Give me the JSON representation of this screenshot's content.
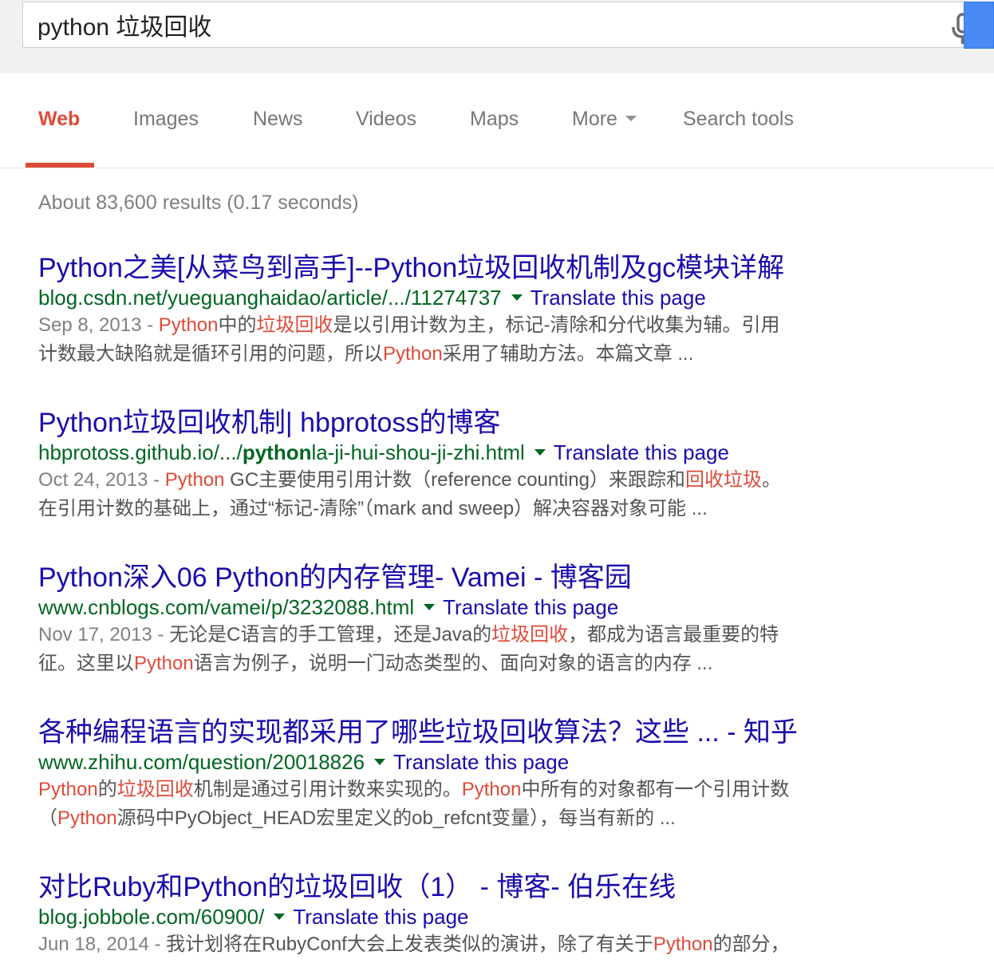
{
  "search": {
    "query": "python 垃圾回收",
    "mic_icon": "microphone-icon",
    "button_color": "#4a8af4"
  },
  "tabs": [
    {
      "label": "Web",
      "active": true
    },
    {
      "label": "Images",
      "active": false
    },
    {
      "label": "News",
      "active": false
    },
    {
      "label": "Videos",
      "active": false
    },
    {
      "label": "Maps",
      "active": false
    },
    {
      "label": "More",
      "active": false
    },
    {
      "label": "Search tools",
      "active": false
    }
  ],
  "stats": "About 83,600 results (0.17 seconds)",
  "colors": {
    "accent": "#dd4b39",
    "link": "#1a0dab",
    "url": "#006621",
    "snippet": "#545454",
    "muted": "#808080"
  },
  "translate_label": "Translate this page",
  "results": [
    {
      "title": "Python之美[从菜鸟到高手]--Python垃圾回收机制及gc模块详解",
      "url_parts": [
        {
          "text": "blog.csdn.net/yueguanghaidao/article/.../11274737",
          "bold": false
        }
      ],
      "snippet_lines": [
        [
          {
            "t": "Sep 8, 2013 - ",
            "k": "date"
          },
          {
            "t": "Python",
            "k": "hl"
          },
          {
            "t": "中的",
            "k": ""
          },
          {
            "t": "垃圾回收",
            "k": "hl"
          },
          {
            "t": "是以引用计数为主，标记-清除和分代收集为辅。引用",
            "k": ""
          }
        ],
        [
          {
            "t": "计数最大缺陷就是循环引用的问题，所以",
            "k": ""
          },
          {
            "t": "Python",
            "k": "hl"
          },
          {
            "t": "采用了辅助方法。本篇文章 ...",
            "k": ""
          }
        ]
      ]
    },
    {
      "title": "Python垃圾回收机制| hbprotoss的博客",
      "url_parts": [
        {
          "text": "hbprotoss.github.io/.../",
          "bold": false
        },
        {
          "text": "python",
          "bold": true
        },
        {
          "text": "la-ji-hui-shou-ji-zhi.html",
          "bold": false
        }
      ],
      "snippet_lines": [
        [
          {
            "t": "Oct 24, 2013 - ",
            "k": "date"
          },
          {
            "t": "Python",
            "k": "hl"
          },
          {
            "t": " GC主要使用引用计数（reference counting）来跟踪和",
            "k": ""
          },
          {
            "t": "回收垃圾",
            "k": "hl"
          },
          {
            "t": "。",
            "k": ""
          }
        ],
        [
          {
            "t": "在引用计数的基础上，通过“标记-清除”（mark and sweep）解决容器对象可能 ...",
            "k": ""
          }
        ]
      ]
    },
    {
      "title": "Python深入06 Python的内存管理- Vamei - 博客园",
      "url_parts": [
        {
          "text": "www.cnblogs.com/vamei/p/3232088.html",
          "bold": false
        }
      ],
      "snippet_lines": [
        [
          {
            "t": "Nov 17, 2013 - ",
            "k": "date"
          },
          {
            "t": "无论是C语言的手工管理，还是Java的",
            "k": ""
          },
          {
            "t": "垃圾回收",
            "k": "hl"
          },
          {
            "t": "，都成为语言最重要的特",
            "k": ""
          }
        ],
        [
          {
            "t": "征。这里以",
            "k": ""
          },
          {
            "t": "Python",
            "k": "hl"
          },
          {
            "t": "语言为例子，说明一门动态类型的、面向对象的语言的内存  ...",
            "k": ""
          }
        ]
      ]
    },
    {
      "title": "各种编程语言的实现都采用了哪些垃圾回收算法？这些 ... - 知乎",
      "url_parts": [
        {
          "text": "www.zhihu.com/question/20018826",
          "bold": false
        }
      ],
      "snippet_lines": [
        [
          {
            "t": "Python",
            "k": "hl"
          },
          {
            "t": "的",
            "k": ""
          },
          {
            "t": "垃圾回收",
            "k": "hl"
          },
          {
            "t": "机制是通过引用计数来实现的。",
            "k": ""
          },
          {
            "t": "Python",
            "k": "hl"
          },
          {
            "t": "中所有的对象都有一个引用计数",
            "k": ""
          }
        ],
        [
          {
            "t": "（",
            "k": ""
          },
          {
            "t": "Python",
            "k": "hl"
          },
          {
            "t": "源码中PyObject_HEAD宏里定义的ob_refcnt变量），每当有新的  ...",
            "k": ""
          }
        ]
      ]
    },
    {
      "title": "对比Ruby和Python的垃圾回收（1）  - 博客- 伯乐在线",
      "url_parts": [
        {
          "text": "blog.jobbole.com/60900/",
          "bold": false
        }
      ],
      "snippet_lines": [
        [
          {
            "t": "Jun 18, 2014 - ",
            "k": "date"
          },
          {
            "t": "我计划将在RubyConf大会上发表类似的演讲，除了有关于",
            "k": ""
          },
          {
            "t": "Python",
            "k": "hl"
          },
          {
            "t": "的部分，",
            "k": ""
          }
        ]
      ]
    }
  ]
}
